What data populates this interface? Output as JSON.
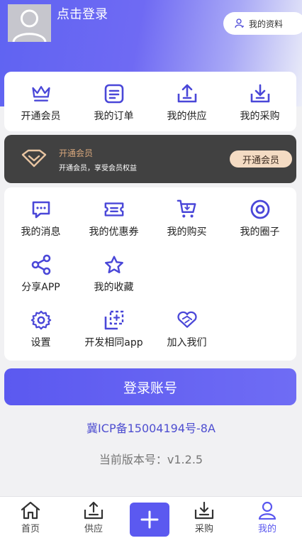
{
  "header": {
    "login_title": "点击登录",
    "profile_button": "我的资料"
  },
  "orders_grid": [
    {
      "label": "开通会员",
      "icon": "crown-icon"
    },
    {
      "label": "我的订单",
      "icon": "order-icon"
    },
    {
      "label": "我的供应",
      "icon": "upload-icon"
    },
    {
      "label": "我的采购",
      "icon": "download-icon"
    }
  ],
  "vip_banner": {
    "title": "开通会员",
    "subtitle": "开通会员，享受会员权益",
    "button": "开通会员",
    "accent_color": "#d8a77c"
  },
  "services_grid": [
    {
      "label": "我的消息",
      "icon": "message-icon"
    },
    {
      "label": "我的优惠券",
      "icon": "coupon-icon"
    },
    {
      "label": "我的购买",
      "icon": "cart-icon"
    },
    {
      "label": "我的圈子",
      "icon": "circle-icon"
    },
    {
      "label": "分享APP",
      "icon": "share-icon"
    },
    {
      "label": "我的收藏",
      "icon": "star-icon"
    },
    {
      "label": "设置",
      "icon": "gear-icon"
    },
    {
      "label": "开发相同app",
      "icon": "copy-icon"
    },
    {
      "label": "加入我们",
      "icon": "heart-handshake-icon"
    }
  ],
  "login_button": "登录账号",
  "icp": "冀ICP备15004194号-8A",
  "version": "当前版本号：v1.2.5",
  "tabbar": [
    {
      "label": "首页",
      "icon": "home-icon"
    },
    {
      "label": "供应",
      "icon": "supply-icon"
    },
    {
      "label": "",
      "icon": "plus-icon"
    },
    {
      "label": "采购",
      "icon": "purchase-icon"
    },
    {
      "label": "我的",
      "icon": "user-icon",
      "active": true
    }
  ],
  "colors": {
    "primary": "#5b59f0",
    "icon": "#4a47d8",
    "vip_bg": "#414141",
    "vip_button_bg": "#f4dbc3"
  }
}
